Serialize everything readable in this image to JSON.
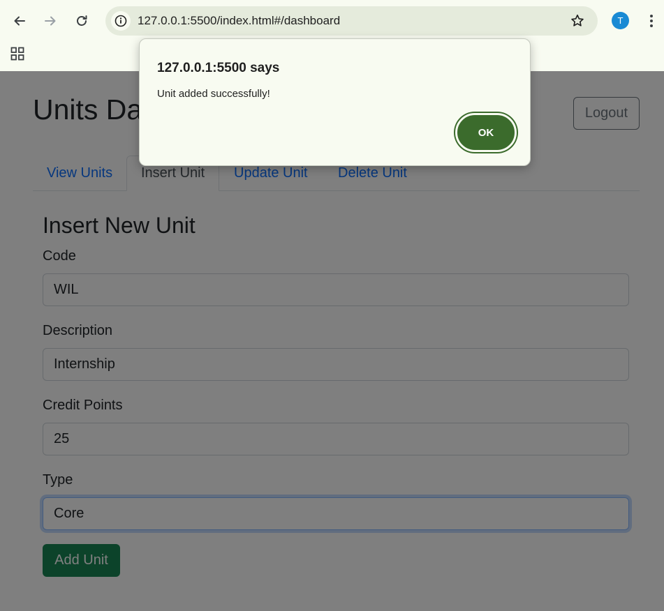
{
  "browser": {
    "url": "127.0.0.1:5500/index.html#/dashboard",
    "profile_initial": "T"
  },
  "page": {
    "title": "Units Dashboard",
    "logout_label": "Logout",
    "tabs": [
      {
        "label": "View Units",
        "active": false
      },
      {
        "label": "Insert Unit",
        "active": true
      },
      {
        "label": "Update Unit",
        "active": false
      },
      {
        "label": "Delete Unit",
        "active": false
      }
    ]
  },
  "form": {
    "title": "Insert New Unit",
    "fields": [
      {
        "label": "Code",
        "value": "WIL"
      },
      {
        "label": "Description",
        "value": "Internship"
      },
      {
        "label": "Credit Points",
        "value": "25"
      },
      {
        "label": "Type",
        "value": "Core"
      }
    ],
    "submit_label": "Add Unit"
  },
  "dialog": {
    "title": "127.0.0.1:5500 says",
    "message": "Unit added successfully!",
    "ok_label": "OK"
  },
  "colors": {
    "accent": "#0d6efd",
    "success": "#198754",
    "dialog_button": "#3b6b2c"
  }
}
